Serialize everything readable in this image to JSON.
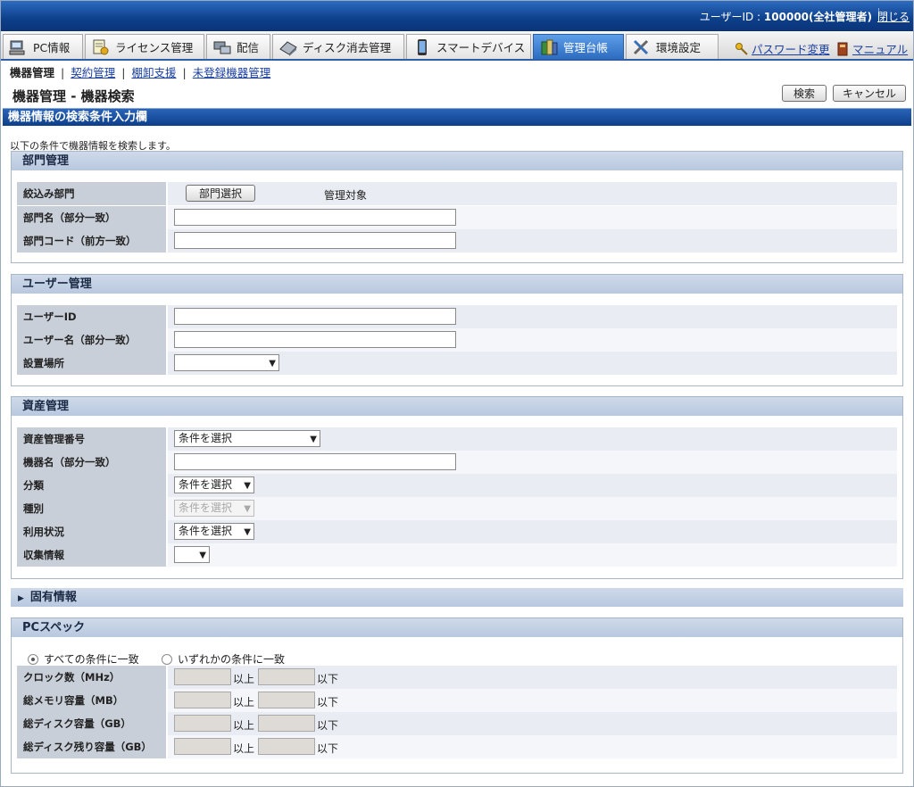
{
  "header": {
    "user_label": "ユーザーID : ",
    "user_id": "100000(全社管理者)",
    "close": "閉じる"
  },
  "nav": {
    "tabs": [
      {
        "label": "PC情報",
        "icon": "pc-icon"
      },
      {
        "label": "ライセンス管理",
        "icon": "license-icon"
      },
      {
        "label": "配信",
        "icon": "distribution-icon"
      },
      {
        "label": "ディスク消去管理",
        "icon": "disk-erase-icon"
      },
      {
        "label": "スマートデバイス",
        "icon": "smart-device-icon"
      },
      {
        "label": "管理台帳",
        "icon": "ledger-icon",
        "active": true
      },
      {
        "label": "環境設定",
        "icon": "settings-tools-icon"
      }
    ],
    "password": "パスワード変更",
    "manual": "マニュアル"
  },
  "subnav": {
    "current": "機器管理",
    "links": [
      "契約管理",
      "棚卸支援",
      "未登録機器管理"
    ]
  },
  "page": {
    "title": "機器管理 - 機器検索",
    "search_button": "検索",
    "cancel_button": "キャンセル"
  },
  "section": {
    "title": "機器情報の検索条件入力欄",
    "intro": "以下の条件で機器情報を検索します。"
  },
  "dept": {
    "title": "部門管理",
    "filter_label": "絞込み部門",
    "select_button": "部門選択",
    "scope": "管理対象",
    "name_label": "部門名（部分一致）",
    "code_label": "部門コード（前方一致）"
  },
  "user": {
    "title": "ユーザー管理",
    "id_label": "ユーザーID",
    "name_label": "ユーザー名（部分一致）",
    "location_label": "設置場所",
    "location_value": ""
  },
  "asset": {
    "title": "資産管理",
    "number_label": "資産管理番号",
    "number_value": "条件を選択",
    "device_label": "機器名（部分一致）",
    "class_label": "分類",
    "class_value": "条件を選択",
    "kind_label": "種別",
    "kind_value": "条件を選択",
    "usage_label": "利用状況",
    "usage_value": "条件を選択",
    "collect_label": "収集情報",
    "collect_value": ""
  },
  "specific": {
    "title": "固有情報"
  },
  "pcspec": {
    "title": "PCスペック",
    "radio_all": "すべての条件に一致",
    "radio_any": "いずれかの条件に一致",
    "above": "以上",
    "below": "以下",
    "rows": [
      "クロック数（MHz）",
      "総メモリ容量（MB）",
      "総ディスク容量（GB）",
      "総ディスク残り容量（GB）"
    ]
  }
}
